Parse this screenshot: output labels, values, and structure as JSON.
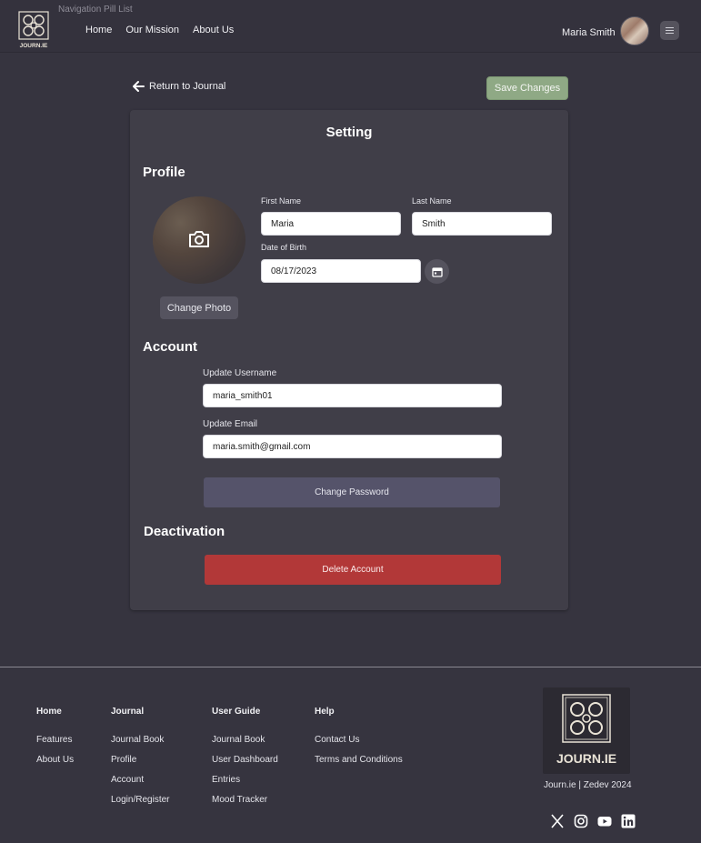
{
  "header": {
    "caption": "Navigation Pill List",
    "logo_text": "JOURN.IE",
    "nav": [
      "Home",
      "Our Mission",
      "About Us"
    ],
    "user_name": "Maria Smith"
  },
  "page": {
    "back_label": "Return to Journal",
    "save_label": "Save Changes",
    "title": "Setting"
  },
  "profile": {
    "heading": "Profile",
    "change_photo_label": "Change Photo",
    "first_name_label": "First Name",
    "first_name_value": "Maria",
    "last_name_label": "Last Name",
    "last_name_value": "Smith",
    "dob_label": "Date of Birth",
    "dob_value": "08/17/2023"
  },
  "account": {
    "heading": "Account",
    "username_label": "Update Username",
    "username_value": "maria_smith01",
    "email_label": "Update Email",
    "email_value": "maria.smith@gmail.com",
    "change_password_label": "Change Password"
  },
  "deactivation": {
    "heading": "Deactivation",
    "delete_label": "Delete Account"
  },
  "footer": {
    "columns": [
      {
        "heading": "Home",
        "items": [
          "Features",
          "About Us"
        ]
      },
      {
        "heading": "Journal",
        "items": [
          "Journal Book",
          "Profile",
          "Account",
          "Login/Register"
        ]
      },
      {
        "heading": "User Guide",
        "items": [
          "Journal Book",
          "User Dashboard",
          "Entries",
          "Mood Tracker"
        ]
      },
      {
        "heading": "Help",
        "items": [
          "Contact Us",
          "Terms and Conditions"
        ]
      }
    ],
    "logo_text": "JOURN.IE",
    "copyright": "Journ.ie | Zedev 2024",
    "socials": [
      "x-icon",
      "instagram-icon",
      "youtube-icon",
      "linkedin-icon"
    ]
  },
  "colors": {
    "background": "#36343f",
    "card": "#403e48",
    "save": "#8fa985",
    "danger": "#b23838",
    "neutral_button": "#55536a"
  }
}
